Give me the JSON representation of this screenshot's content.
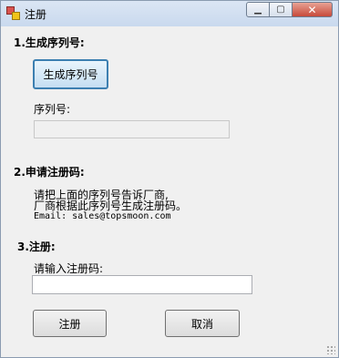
{
  "window": {
    "title": "注册",
    "close_glyph": "✕",
    "min_glyph": "▁",
    "max_glyph": "▢"
  },
  "step1": {
    "heading": "1.生成序列号:",
    "generate_button": "生成序列号",
    "serial_label": "序列号:",
    "serial_value": ""
  },
  "step2": {
    "heading": "2.申请注册码:",
    "line1": "请把上面的序列号告诉厂商,",
    "line2": "厂商根据此序列号生成注册码。",
    "email": "Email: sales@topsmoon.com"
  },
  "step3": {
    "heading": "3.注册:",
    "input_label": "请输入注册码:",
    "input_value": ""
  },
  "buttons": {
    "register": "注册",
    "cancel": "取消"
  },
  "icons": [
    "app-icon",
    "minimize-icon",
    "maximize-icon",
    "close-icon",
    "resize-grip-icon"
  ]
}
